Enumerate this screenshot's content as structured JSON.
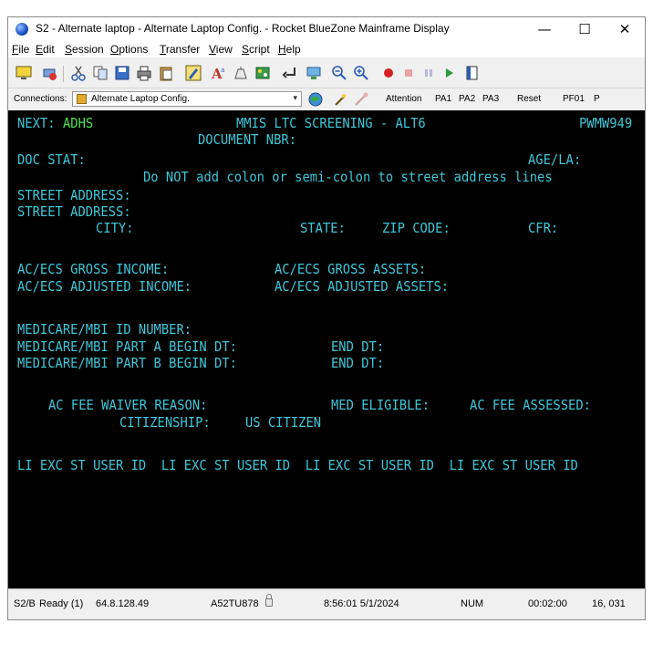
{
  "window": {
    "title": "S2 - Alternate laptop - Alternate Laptop Config. - Rocket BlueZone Mainframe Display",
    "minimize_glyph": "—",
    "maximize_glyph": "☐",
    "close_glyph": "✕"
  },
  "menu": [
    "File",
    "Edit",
    "Session",
    "Options",
    "Transfer",
    "View",
    "Script",
    "Help"
  ],
  "toolbar_icons": [
    "monitor-icon",
    "connect-icon",
    "cut-icon",
    "copy-icon",
    "save-icon",
    "print-icon",
    "paste-icon",
    "edit-icon",
    "font-icon",
    "clear-icon",
    "macro-icon",
    "enter-icon",
    "send-icon",
    "zoom-out-icon",
    "zoom-in-icon",
    "record-icon",
    "stop-icon",
    "pause-icon",
    "play-icon",
    "book-icon"
  ],
  "connections": {
    "label": "Connections:",
    "selected": "Alternate Laptop Config."
  },
  "keys": [
    "Attention",
    "PA1",
    "PA2",
    "PA3",
    "Reset",
    "PF01",
    "P"
  ],
  "screen": {
    "next_label": "NEXT:",
    "next_value": "ADHS",
    "screen_title": "MMIS LTC SCREENING - ALT6",
    "screen_id": "PWMW949",
    "document_nbr": "DOCUMENT NBR:",
    "doc_stat": "DOC STAT:",
    "age_la": "AGE/LA:",
    "notice": "Do NOT add colon or semi-colon to street address lines",
    "street1": "STREET ADDRESS:",
    "street2": "STREET ADDRESS:",
    "city": "CITY:",
    "state": "STATE:",
    "zip": "ZIP CODE:",
    "cfr": "CFR:",
    "gross_income": "AC/ECS GROSS INCOME:",
    "gross_assets": "AC/ECS GROSS ASSETS:",
    "adj_income": "AC/ECS ADJUSTED INCOME:",
    "adj_assets": "AC/ECS ADJUSTED ASSETS:",
    "medicare_id": "MEDICARE/MBI ID NUMBER:",
    "part_a": "MEDICARE/MBI PART A BEGIN DT:",
    "part_a_end": "END DT:",
    "part_b": "MEDICARE/MBI PART B BEGIN DT:",
    "part_b_end": "END DT:",
    "fee_waiver": "AC FEE WAIVER REASON:",
    "med_eligible": "MED ELIGIBLE:",
    "fee_assessed": "AC FEE ASSESSED:",
    "citizenship_label": "CITIZENSHIP:",
    "citizenship_value": "US CITIZEN",
    "li_header": "LI EXC ST USER ID  LI EXC ST USER ID  LI EXC ST USER ID  LI EXC ST USER ID"
  },
  "status": {
    "session": "S2/B",
    "state": "Ready (1)",
    "ip": "64.8.128.49",
    "terminal_id": "A52TU878",
    "datetime": "8:56:01 5/1/2024",
    "num": "NUM",
    "elapsed": "00:02:00",
    "cursor": "16, 031"
  }
}
